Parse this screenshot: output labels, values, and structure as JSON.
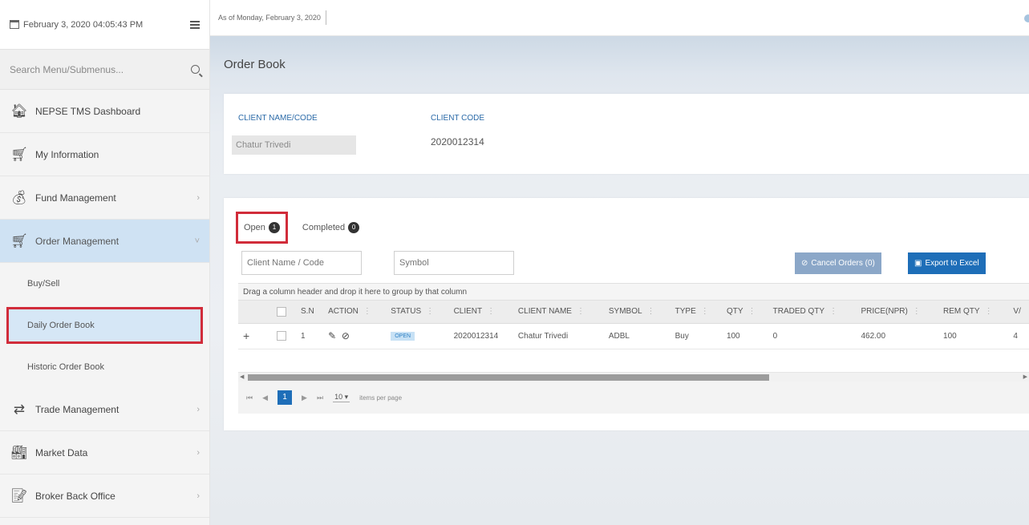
{
  "sidebar": {
    "datetime": "February 3, 2020 04:05:43 PM",
    "search_placeholder": "Search Menu/Submenus...",
    "items": [
      {
        "label": "NEPSE TMS Dashboard",
        "icon": "home-icon"
      },
      {
        "label": "My Information",
        "icon": "cart-icon"
      },
      {
        "label": "Fund Management",
        "icon": "money-bag-icon",
        "chevron": "›"
      },
      {
        "label": "Order Management",
        "icon": "cart-icon",
        "chevron": "˅",
        "expanded": true
      },
      {
        "label": "Trade Management",
        "icon": "trade-icon",
        "chevron": "›"
      },
      {
        "label": "Market Data",
        "icon": "factory-icon",
        "chevron": "›"
      },
      {
        "label": "Broker Back Office",
        "icon": "document-edit-icon",
        "chevron": "›"
      }
    ],
    "subitems": [
      {
        "label": "Buy/Sell"
      },
      {
        "label": "Daily Order Book",
        "selected": true
      },
      {
        "label": "Historic Order Book"
      }
    ]
  },
  "topbar": {
    "as_of": "As of Monday, February 3, 2020"
  },
  "page": {
    "title": "Order Book"
  },
  "client": {
    "name_label": "CLIENT NAME/CODE",
    "code_label": "CLIENT CODE",
    "name_value": "Chatur Trivedi",
    "code_value": "2020012314"
  },
  "orders": {
    "tabs": [
      {
        "label": "Open",
        "count": "1"
      },
      {
        "label": "Completed",
        "count": "0"
      }
    ],
    "filter_client_placeholder": "Client Name / Code",
    "filter_symbol_placeholder": "Symbol",
    "cancel_label": "Cancel Orders (0)",
    "export_label": "Export to Excel",
    "group_hint": "Drag a column header and drop it here to group by that column",
    "columns": [
      "S.N",
      "ACTION",
      "STATUS",
      "CLIENT",
      "CLIENT NAME",
      "SYMBOL",
      "TYPE",
      "QTY",
      "TRADED QTY",
      "PRICE(NPR)",
      "REM QTY",
      "V/"
    ],
    "rows": [
      {
        "sn": "1",
        "status": "OPEN",
        "client": "2020012314",
        "client_name": "Chatur Trivedi",
        "symbol": "ADBL",
        "type": "Buy",
        "qty": "100",
        "traded_qty": "0",
        "price": "462.00",
        "rem_qty": "100",
        "v": "4"
      }
    ],
    "pager": {
      "current_page": "1",
      "page_size": "10",
      "items_per_page": "items per page"
    }
  },
  "colors": {
    "accent": "#1e6eb8",
    "highlight_border": "#d12c3a",
    "active_nav_bg": "#cfe2f3"
  }
}
